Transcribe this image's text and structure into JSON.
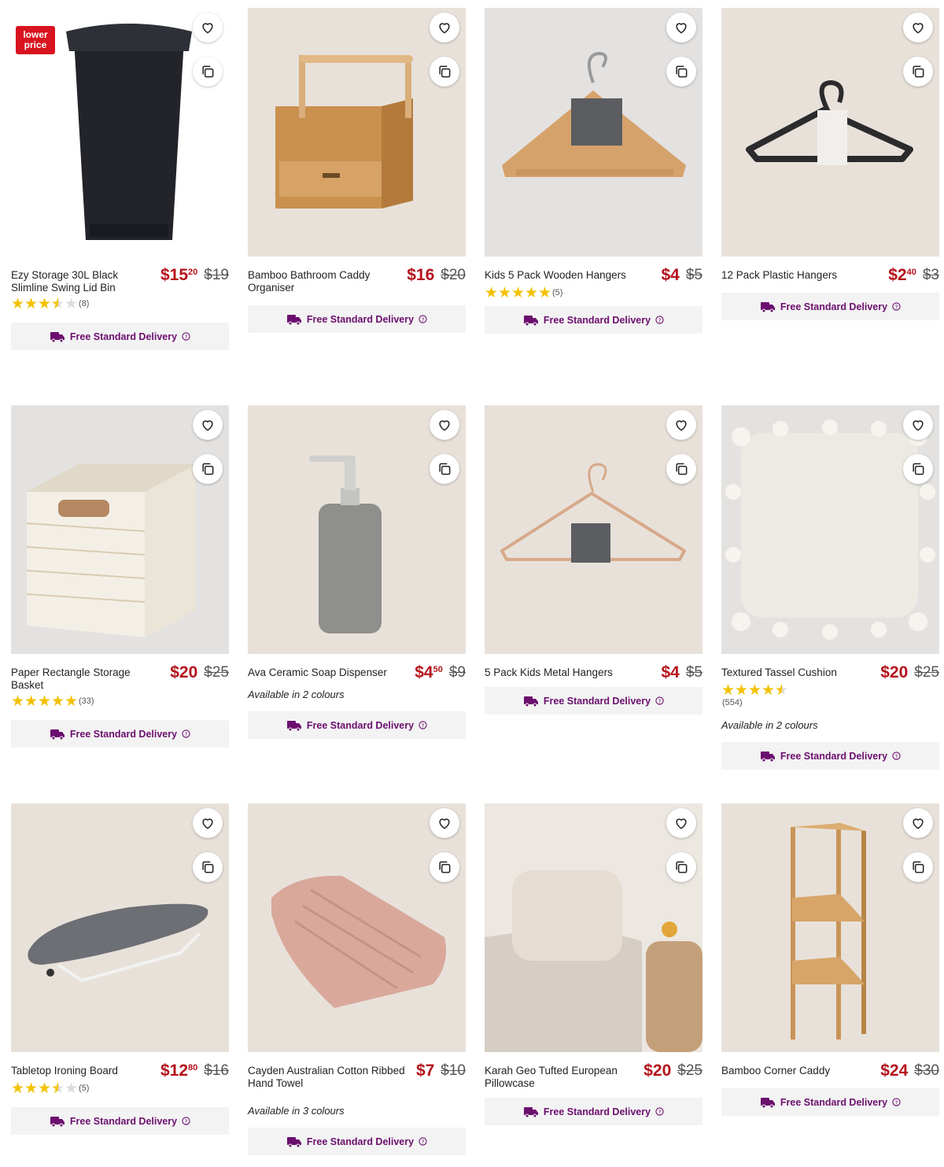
{
  "colors": {
    "price": "#b5121b",
    "delivery": "#6b0f6e",
    "star": "#f2c200",
    "badge": "#d8131f"
  },
  "delivery_label": "Free Standard Delivery",
  "products": [
    {
      "name": "Ezy Storage 30L Black Slimline Swing Lid Bin",
      "price_main": "$15",
      "price_cents": "20",
      "was": "$19",
      "rating": 3.5,
      "reviews": "(8)",
      "badge": "lower price",
      "image": "black-swing-lid-bin"
    },
    {
      "name": "Bamboo Bathroom Caddy Organiser",
      "price_main": "$16",
      "price_cents": "",
      "was": "$20",
      "image": "bamboo-caddy"
    },
    {
      "name": "Kids 5 Pack Wooden Hangers",
      "price_main": "$4",
      "price_cents": "",
      "was": "$5",
      "rating": 5,
      "reviews": "(5)",
      "image": "wooden-hangers"
    },
    {
      "name": "12 Pack Plastic Hangers",
      "price_main": "$2",
      "price_cents": "40",
      "was": "$3",
      "image": "plastic-hangers"
    },
    {
      "name": "Paper Rectangle Storage Basket",
      "price_main": "$20",
      "price_cents": "",
      "was": "$25",
      "rating": 5,
      "reviews": "(33)",
      "image": "storage-basket"
    },
    {
      "name": "Ava Ceramic Soap Dispenser",
      "price_main": "$4",
      "price_cents": "50",
      "was": "$9",
      "colours": "Available in 2 colours",
      "image": "soap-dispenser"
    },
    {
      "name": "5 Pack Kids Metal Hangers",
      "price_main": "$4",
      "price_cents": "",
      "was": "$5",
      "image": "metal-hangers"
    },
    {
      "name": "Textured Tassel Cushion",
      "price_main": "$20",
      "price_cents": "",
      "was": "$25",
      "rating": 4.5,
      "reviews": "(554)",
      "colours": "Available in 2 colours",
      "image": "tassel-cushion"
    },
    {
      "name": "Tabletop Ironing Board",
      "price_main": "$12",
      "price_cents": "80",
      "was": "$16",
      "rating": 3.5,
      "reviews": "(5)",
      "image": "ironing-board"
    },
    {
      "name": "Cayden Australian Cotton Ribbed Hand Towel",
      "price_main": "$7",
      "price_cents": "",
      "was": "$10",
      "colours": "Available in 3 colours",
      "image": "hand-towel"
    },
    {
      "name": "Karah Geo Tufted European Pillowcase",
      "price_main": "$20",
      "price_cents": "",
      "was": "$25",
      "image": "pillowcase"
    },
    {
      "name": "Bamboo Corner Caddy",
      "price_main": "$24",
      "price_cents": "",
      "was": "$30",
      "image": "corner-caddy"
    }
  ]
}
